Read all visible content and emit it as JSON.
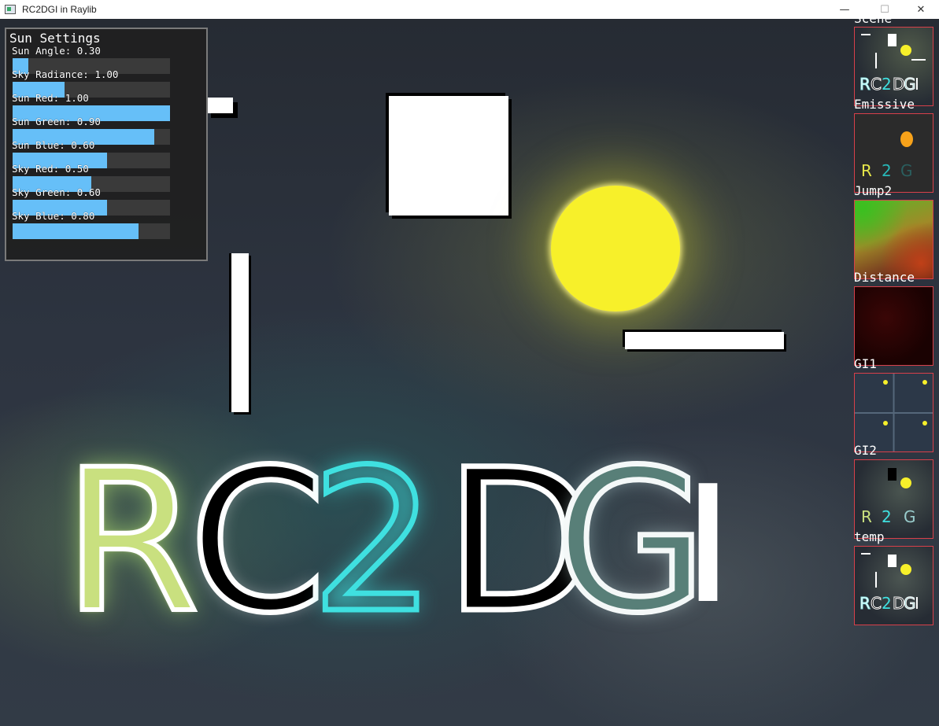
{
  "window": {
    "title": "RC2DGI in Raylib",
    "minimize_glyph": "—",
    "maximize_glyph": "☐",
    "close_glyph": "✕"
  },
  "scene": {
    "big_letters": [
      "R",
      "C",
      "2",
      "D",
      "G",
      "I"
    ]
  },
  "panel": {
    "title": "Sun Settings",
    "sliders": [
      {
        "label": "Sun Angle: 0.30",
        "fraction": 0.1
      },
      {
        "label": "Sky Radiance: 1.00",
        "fraction": 0.33
      },
      {
        "label": "Sun Red: 1.00",
        "fraction": 1.0
      },
      {
        "label": "Sun Green: 0.90",
        "fraction": 0.9
      },
      {
        "label": "Sun Blue: 0.60",
        "fraction": 0.6
      },
      {
        "label": "Sky Red: 0.50",
        "fraction": 0.5
      },
      {
        "label": "Sky Green: 0.60",
        "fraction": 0.6
      },
      {
        "label": "Sky Blue: 0.80",
        "fraction": 0.8
      }
    ]
  },
  "thumbnails": {
    "scene": "Scene",
    "emissive": "Emissive",
    "jump": "Jump2",
    "distance": "Distance",
    "gi1": "GI1",
    "gi2": "GI2",
    "temp": "temp"
  },
  "colors": {
    "slider_fill": "#66bff8",
    "slider_track": "#3a3a3a",
    "thumb_border": "#d8404a",
    "sun": "#f7f02a",
    "cyan_letter": "#3fe0e0"
  }
}
